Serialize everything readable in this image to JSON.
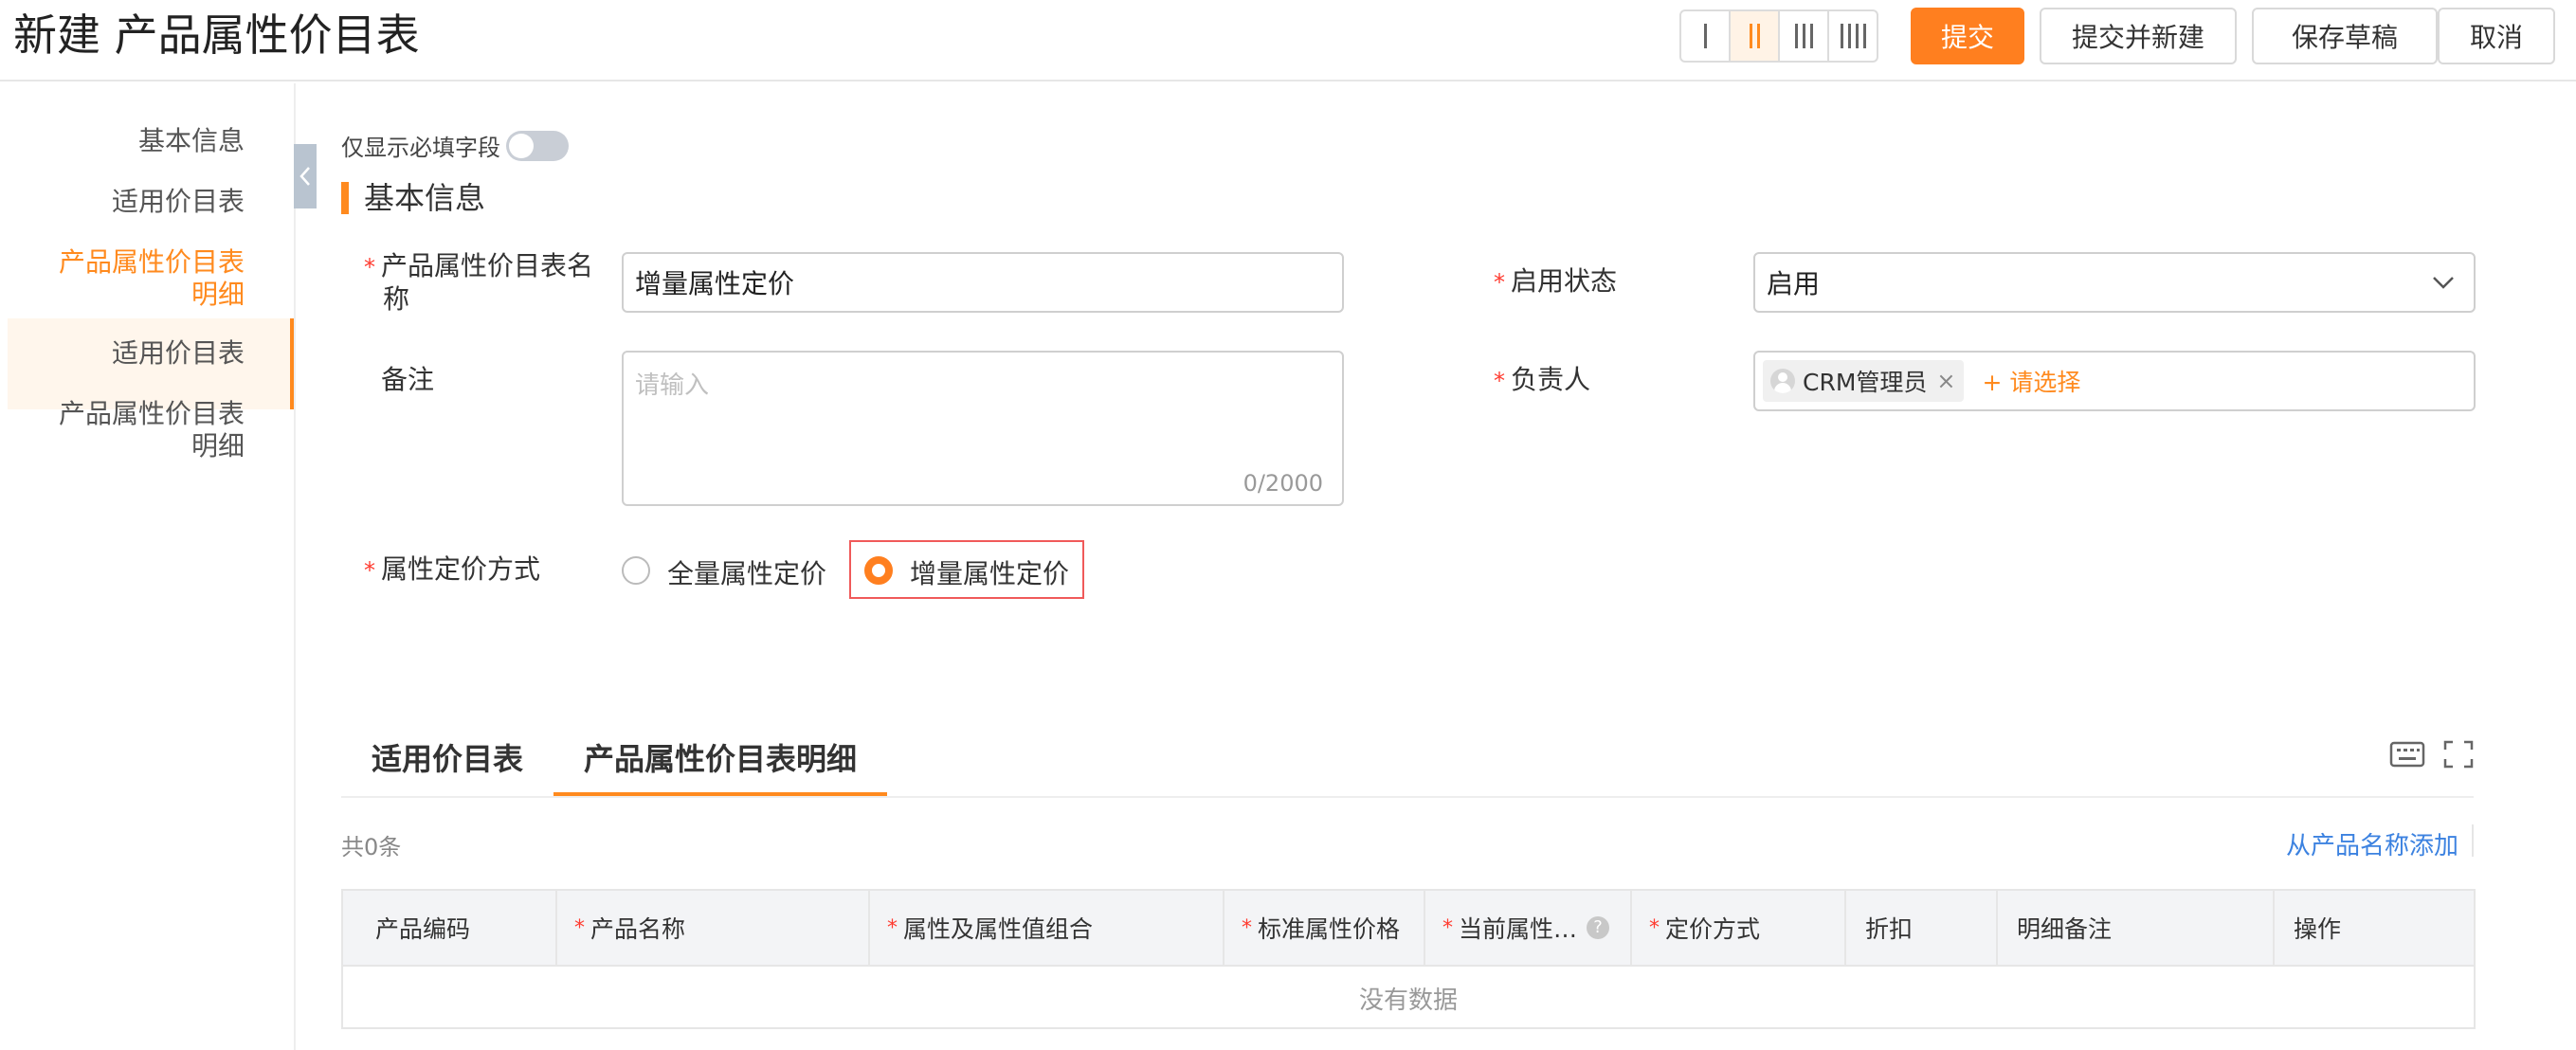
{
  "header": {
    "title": "新建 产品属性价目表",
    "buttons": {
      "submit": "提交",
      "submit_new": "提交并新建",
      "save_draft": "保存草稿",
      "cancel": "取消"
    }
  },
  "sidebar": {
    "items": [
      {
        "label": "基本信息"
      },
      {
        "label": "适用价目表"
      },
      {
        "label": "产品属性价目表明细",
        "line1": "产品属性价目表",
        "line2": "明细",
        "active": true
      },
      {
        "label": "适用价目表"
      },
      {
        "label": "产品属性价目表明细",
        "line1": "产品属性价目表",
        "line2": "明细"
      }
    ]
  },
  "form": {
    "required_toggle_label": "仅显示必填字段",
    "section_title": "基本信息",
    "name": {
      "label_line1": "产品属性价目表名",
      "label_line2": "称",
      "value": "增量属性定价"
    },
    "status": {
      "label": "启用状态",
      "value": "启用"
    },
    "remark": {
      "label": "备注",
      "placeholder": "请输入",
      "counter": "0/2000"
    },
    "owner": {
      "label": "负责人",
      "tag": "CRM管理员",
      "add": "+ 请选择"
    },
    "pricing_mode": {
      "label": "属性定价方式",
      "options": [
        "全量属性定价",
        "增量属性定价"
      ],
      "selected": "增量属性定价"
    }
  },
  "detail": {
    "tabs": [
      "适用价目表",
      "产品属性价目表明细"
    ],
    "active_tab": "产品属性价目表明细",
    "count": "共0条",
    "add_from": "从产品名称添加",
    "columns": [
      {
        "label": "产品编码",
        "required": false
      },
      {
        "label": "产品名称",
        "required": true
      },
      {
        "label": "属性及属性值组合",
        "required": true
      },
      {
        "label": "标准属性价格",
        "required": true
      },
      {
        "label": "当前属性…",
        "required": true,
        "help": true
      },
      {
        "label": "定价方式",
        "required": true
      },
      {
        "label": "折扣",
        "required": false
      },
      {
        "label": "明细备注",
        "required": false
      },
      {
        "label": "操作",
        "required": false
      }
    ],
    "empty_text": "没有数据"
  },
  "colors": {
    "accent": "#ff7f1f",
    "link": "#3c82e0",
    "required": "#ff3b30"
  }
}
